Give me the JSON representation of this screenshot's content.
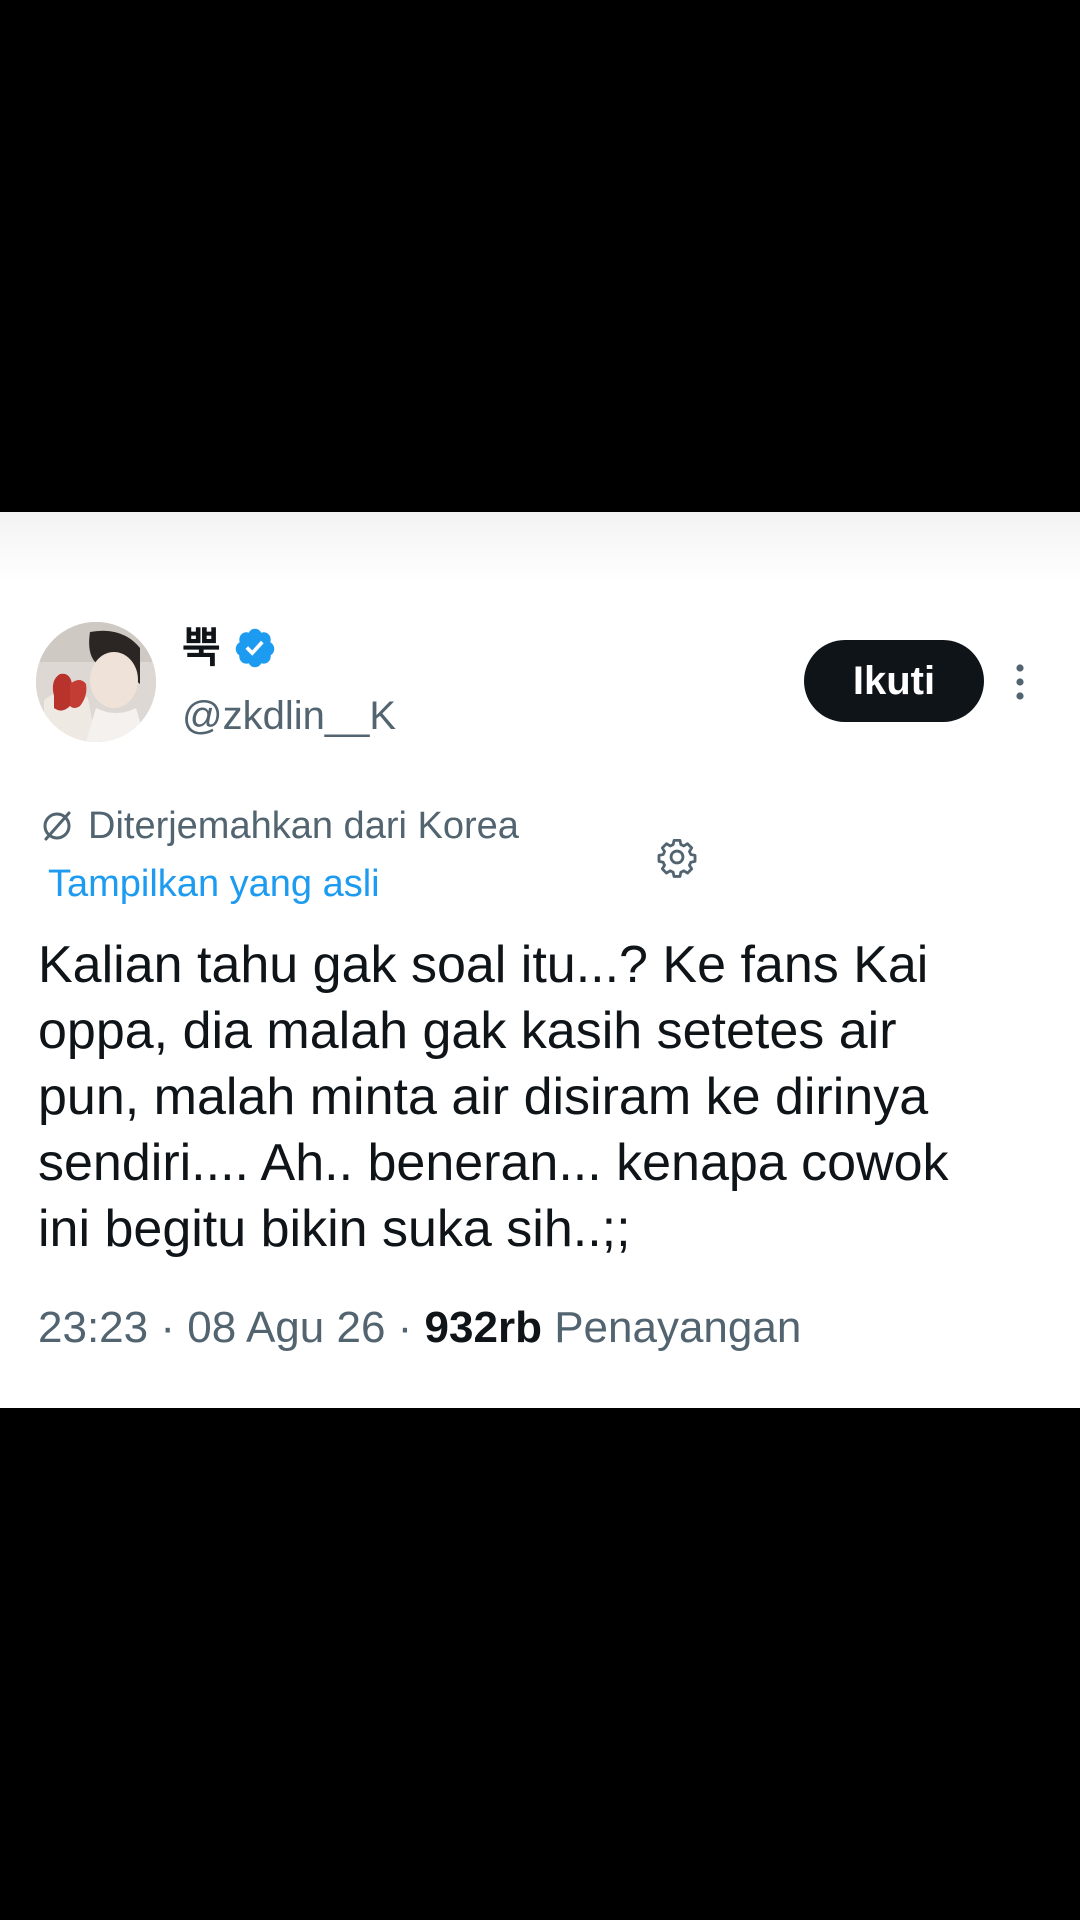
{
  "tweet": {
    "author": {
      "display_name": "뿍",
      "verified": true,
      "handle": "@zkdlin__K"
    },
    "follow_label": "Ikuti",
    "translation": {
      "notice": "Diterjemahkan dari Korea",
      "show_original_label": "Tampilkan yang asli"
    },
    "text": "Kalian tahu gak soal itu...? Ke fans Kai\noppa, dia malah gak kasih setetes air\npun, malah minta air disiram ke dirinya\nsendiri.... Ah.. beneran... kenapa cowok\nini begitu bikin suka sih..;;",
    "meta": {
      "time": "23:23",
      "separator": " · ",
      "date": "08 Agu 26",
      "views_count": "932rb",
      "views_label": "Penayangan"
    }
  },
  "colors": {
    "text_primary": "#0f1419",
    "text_secondary": "#536471",
    "link": "#1d9bf0",
    "verified_badge": "#1d9bf0",
    "follow_button_bg": "#0f1419",
    "follow_button_text": "#ffffff",
    "background_outer": "#000000",
    "card_background": "#ffffff"
  },
  "icons": {
    "verified": "verified-badge-icon",
    "more": "more-vertical-icon",
    "translate": "translate-icon",
    "settings": "gear-icon"
  }
}
